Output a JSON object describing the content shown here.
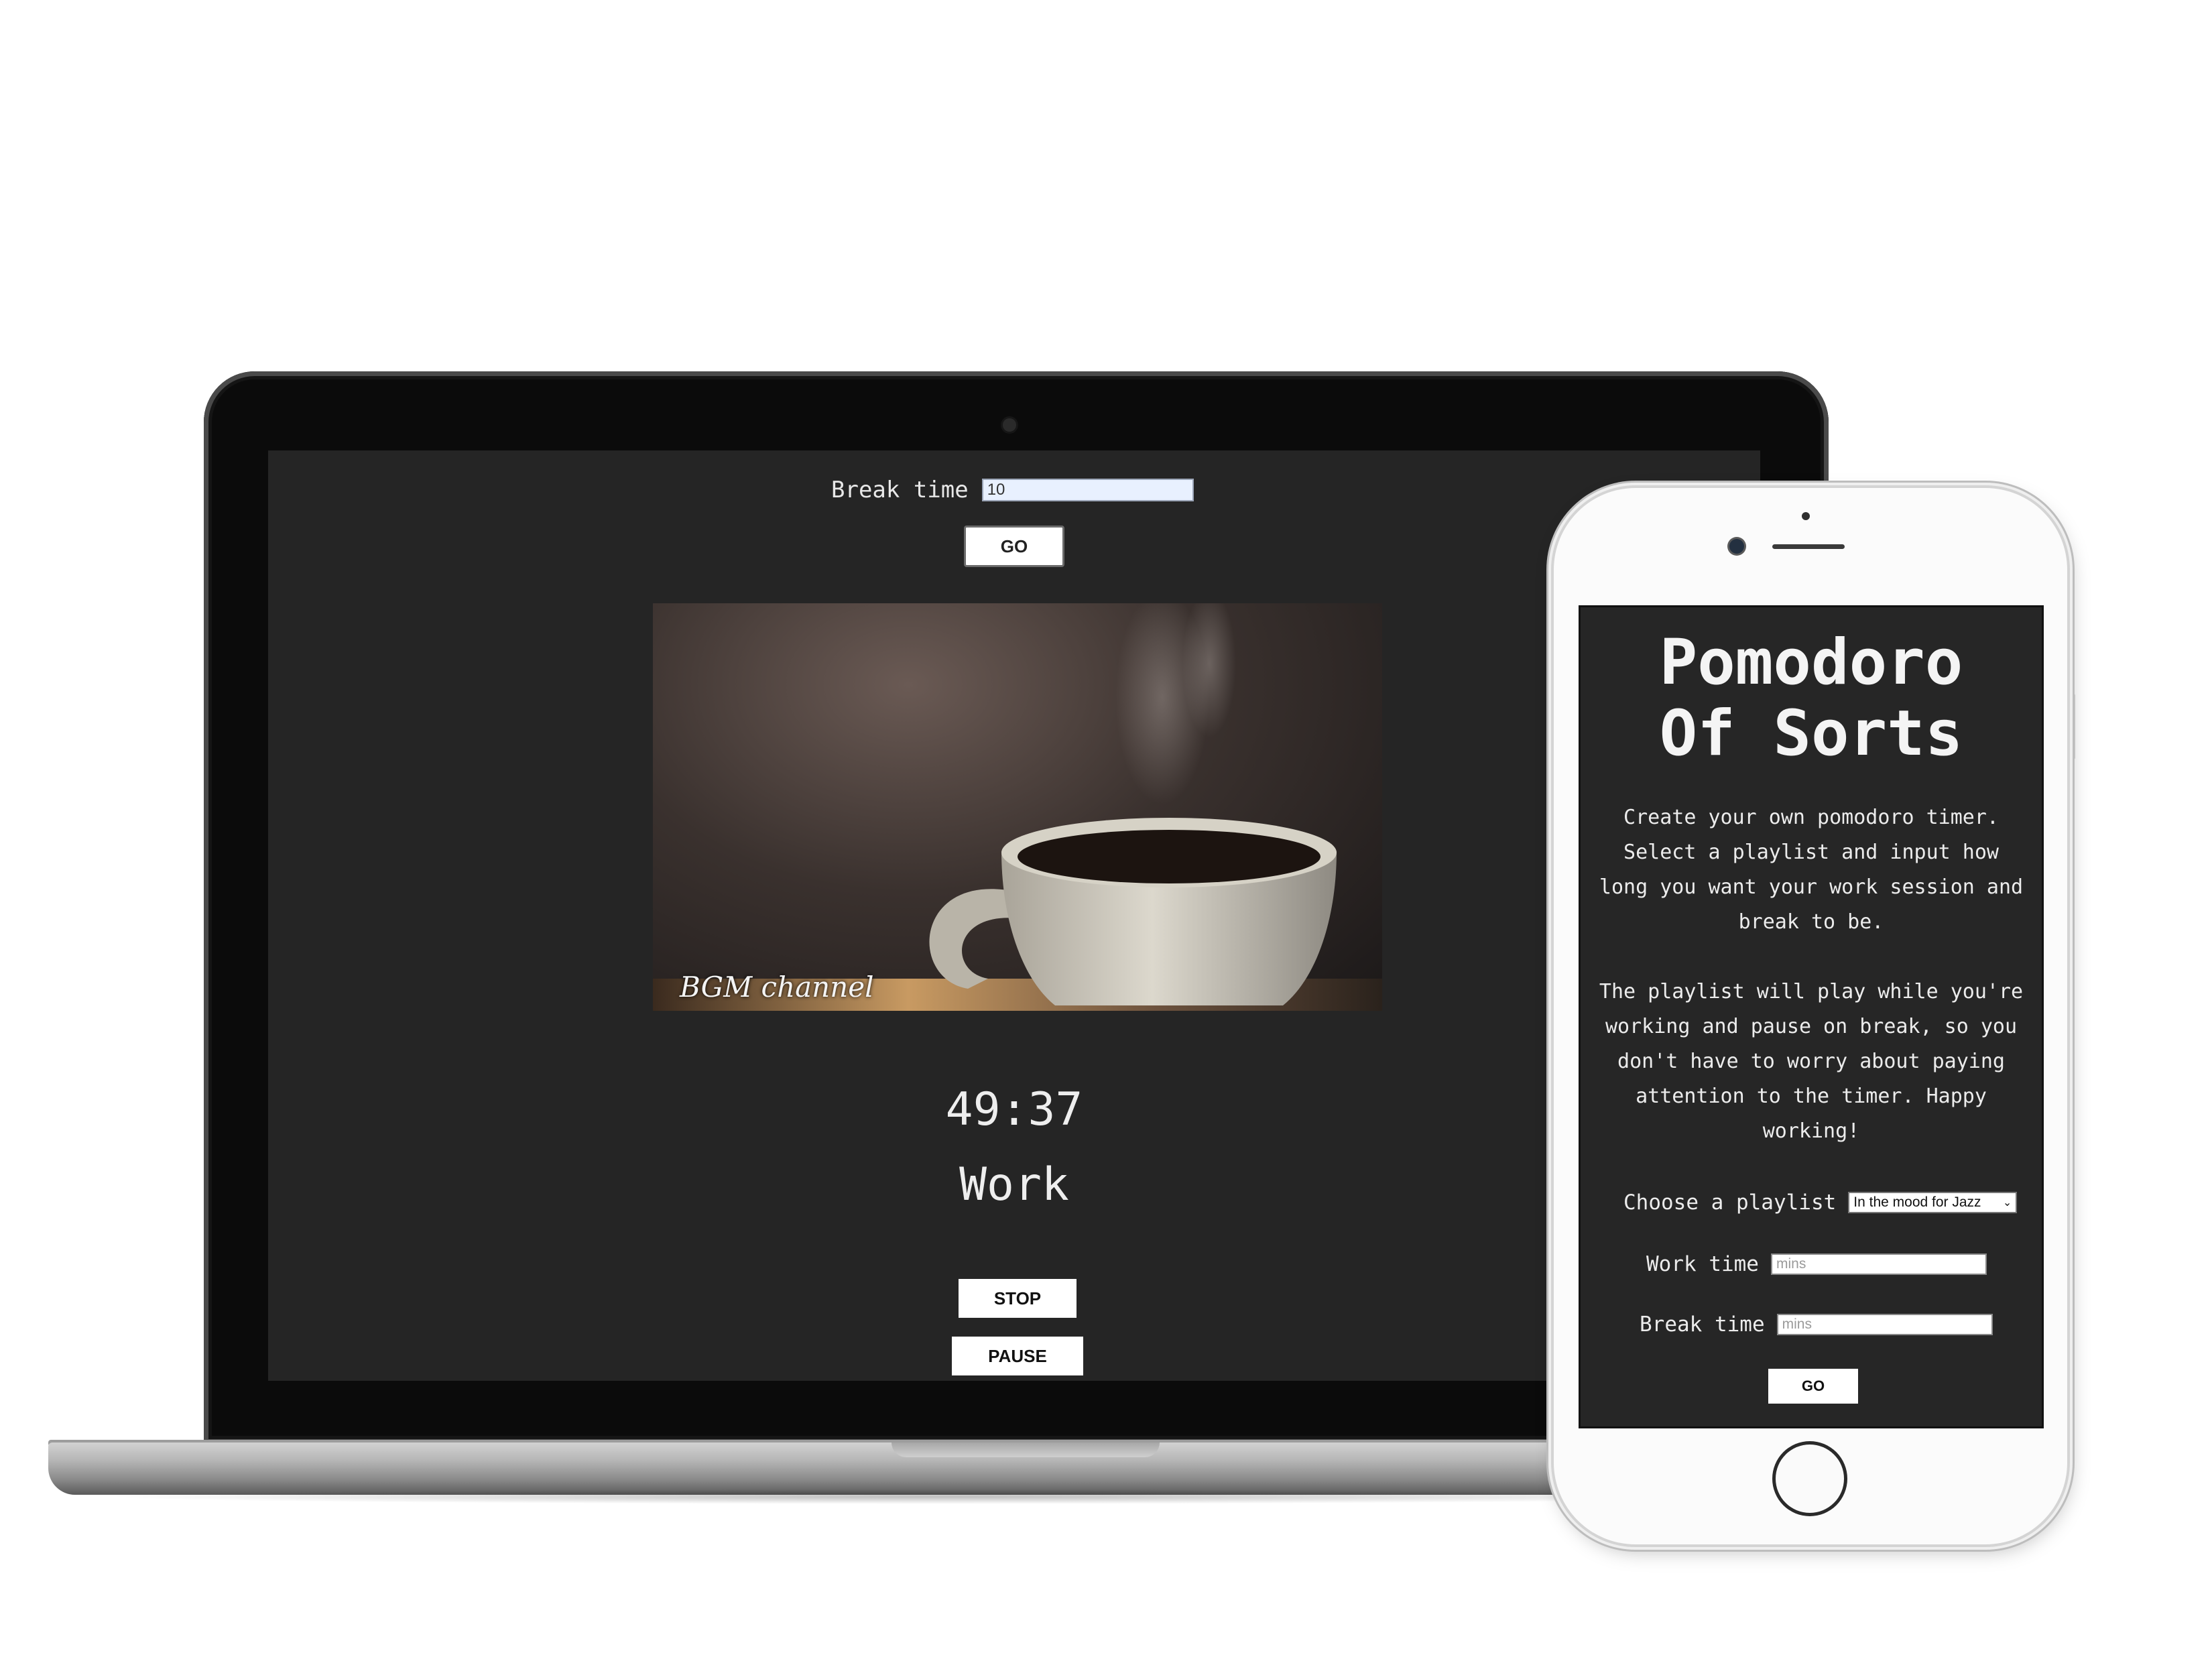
{
  "laptop": {
    "break_time_label": "Break time",
    "break_time_value": "10",
    "go_label": "GO",
    "video": {
      "watermark": "BGM channel"
    },
    "timer": "49:37",
    "mode": "Work",
    "stop_label": "STOP",
    "pause_label": "PAUSE"
  },
  "phone": {
    "title_line1": "Pomodoro",
    "title_line2": "Of Sorts",
    "description_1": "Create your own pomodoro timer. Select a playlist and input how long you want your work session and break to be.",
    "description_2": "The playlist will play while you're working and pause on break, so you don't have to worry about paying attention to the timer. Happy working!",
    "playlist_label": "Choose a playlist",
    "playlist_selected": "In the mood for Jazz",
    "work_time_label": "Work time",
    "work_time_placeholder": "mins",
    "break_time_label": "Break time",
    "break_time_placeholder": "mins",
    "go_label": "GO"
  },
  "colors": {
    "app_background": "#252525",
    "text": "#ececec",
    "button_background": "#ffffff"
  }
}
